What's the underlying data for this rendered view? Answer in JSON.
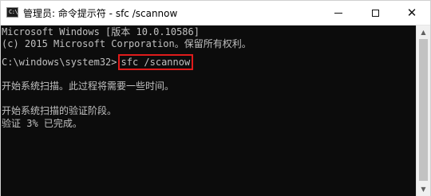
{
  "window": {
    "title": "管理员: 命令提示符 - sfc  /scannow",
    "app_icon_glyph": "C:\\",
    "minimize_icon": "minimize-icon",
    "maximize_icon": "maximize-icon",
    "close_icon": "close-icon",
    "close_glyph": "✕"
  },
  "console": {
    "lines": [
      "Microsoft Windows [版本 10.0.10586]",
      "(c) 2015 Microsoft Corporation。保留所有权利。",
      "",
      "C:\\windows\\system32>",
      "",
      "开始系统扫描。此过程将需要一些时间。",
      "",
      "开始系统扫描的验证阶段。",
      "验证 3% 已完成。"
    ],
    "command": "sfc /scannow",
    "highlight_color": "#e01b1b",
    "text_color": "#c0c0c0",
    "background_color": "#0c0c0c"
  },
  "scrollbar": {
    "up_glyph": "▲",
    "down_glyph": "▼"
  }
}
